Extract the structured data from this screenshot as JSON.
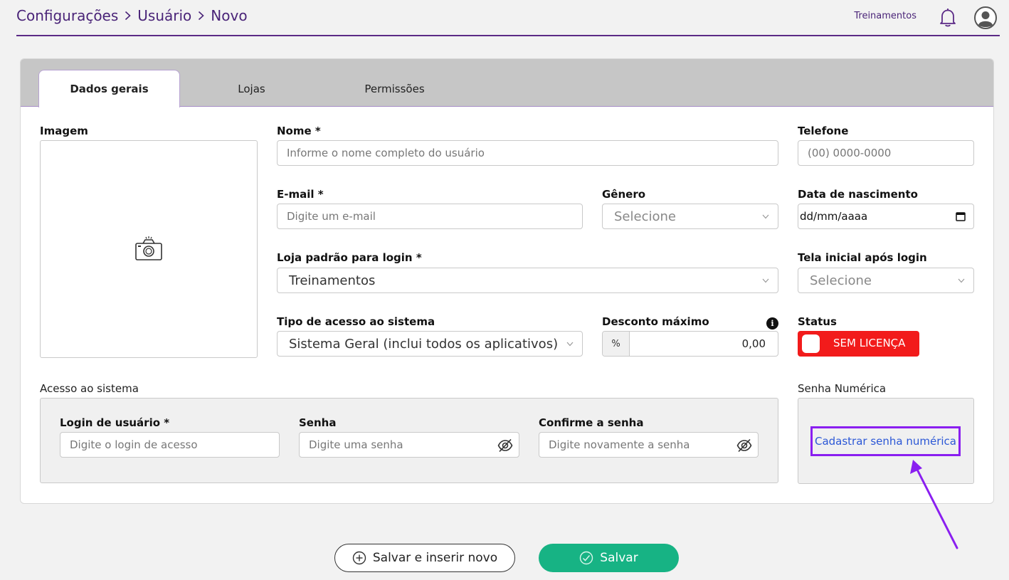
{
  "header": {
    "breadcrumb": [
      "Configurações",
      "Usuário",
      "Novo"
    ],
    "store_name": "Treinamentos"
  },
  "tabs": [
    {
      "label": "Dados gerais",
      "active": true
    },
    {
      "label": "Lojas",
      "active": false
    },
    {
      "label": "Permissões",
      "active": false
    }
  ],
  "form": {
    "image_label": "Imagem",
    "name_label": "Nome *",
    "name_placeholder": "Informe o nome completo do usuário",
    "phone_label": "Telefone",
    "phone_placeholder": "(00) 0000-0000",
    "email_label": "E-mail *",
    "email_placeholder": "Digite um e-mail",
    "gender_label": "Gênero",
    "gender_value": "Selecione",
    "birth_label": "Data de nascimento",
    "birth_value": "dd/mm/aaaa",
    "store_label": "Loja padrão para login *",
    "store_value": "Treinamentos",
    "home_label": "Tela inicial após login",
    "home_value": "Selecione",
    "access_type_label": "Tipo de acesso ao sistema",
    "access_type_value": "Sistema Geral (inclui todos os aplicativos)",
    "discount_label": "Desconto máximo",
    "discount_unit": "%",
    "discount_value": "0,00",
    "discount_info": "i",
    "status_label": "Status",
    "status_value": "SEM LICENÇA"
  },
  "access": {
    "section_label": "Acesso ao sistema",
    "login_label": "Login de usuário *",
    "login_placeholder": "Digite o login de acesso",
    "password_label": "Senha",
    "password_placeholder": "Digite uma senha",
    "confirm_label": "Confirme a senha",
    "confirm_placeholder": "Digite novamente a senha"
  },
  "numeric": {
    "section_label": "Senha Numérica",
    "link": "Cadastrar senha numérica"
  },
  "actions": {
    "save_new": "Salvar e inserir novo",
    "save": "Salvar"
  },
  "colors": {
    "brand": "#4a2478",
    "highlight": "#8a1ff0",
    "save": "#17b384",
    "status": "#f21b1b",
    "link": "#2b57d6"
  }
}
